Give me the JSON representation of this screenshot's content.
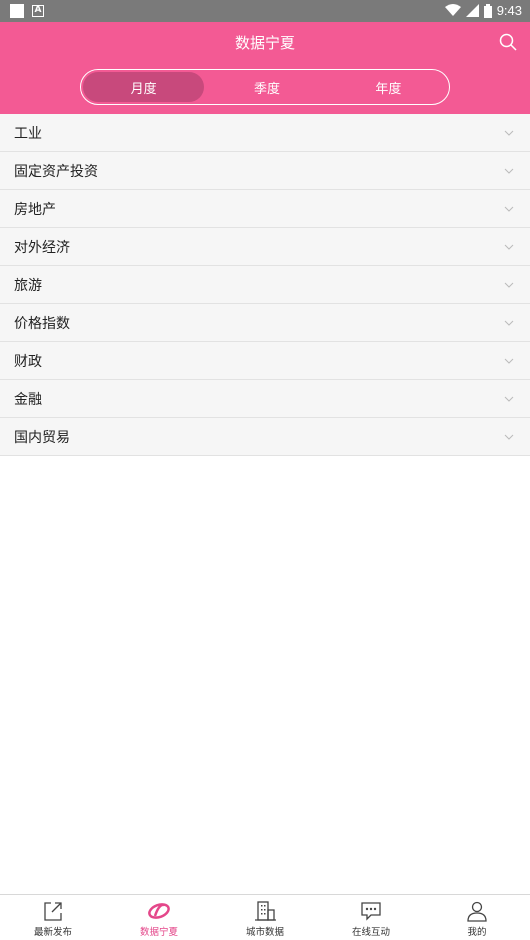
{
  "status_bar": {
    "time": "9:43"
  },
  "header": {
    "title": "数据宁夏",
    "tabs": [
      {
        "label": "月度",
        "active": true
      },
      {
        "label": "季度",
        "active": false
      },
      {
        "label": "年度",
        "active": false
      }
    ]
  },
  "categories": [
    {
      "label": "工业"
    },
    {
      "label": "固定资产投资"
    },
    {
      "label": "房地产"
    },
    {
      "label": "对外经济"
    },
    {
      "label": "旅游"
    },
    {
      "label": "价格指数"
    },
    {
      "label": "财政"
    },
    {
      "label": "金融"
    },
    {
      "label": "国内贸易"
    }
  ],
  "bottom_nav": [
    {
      "label": "最新发布",
      "icon": "share-icon",
      "active": false
    },
    {
      "label": "数据宁夏",
      "icon": "logo-icon",
      "active": true
    },
    {
      "label": "城市数据",
      "icon": "building-icon",
      "active": false
    },
    {
      "label": "在线互动",
      "icon": "chat-icon",
      "active": false
    },
    {
      "label": "我的",
      "icon": "user-icon",
      "active": false
    }
  ],
  "colors": {
    "header": "#f35a94",
    "active_tab": "#c8497c",
    "active_nav": "#e4478a",
    "status_bar": "#7a7a7a"
  }
}
